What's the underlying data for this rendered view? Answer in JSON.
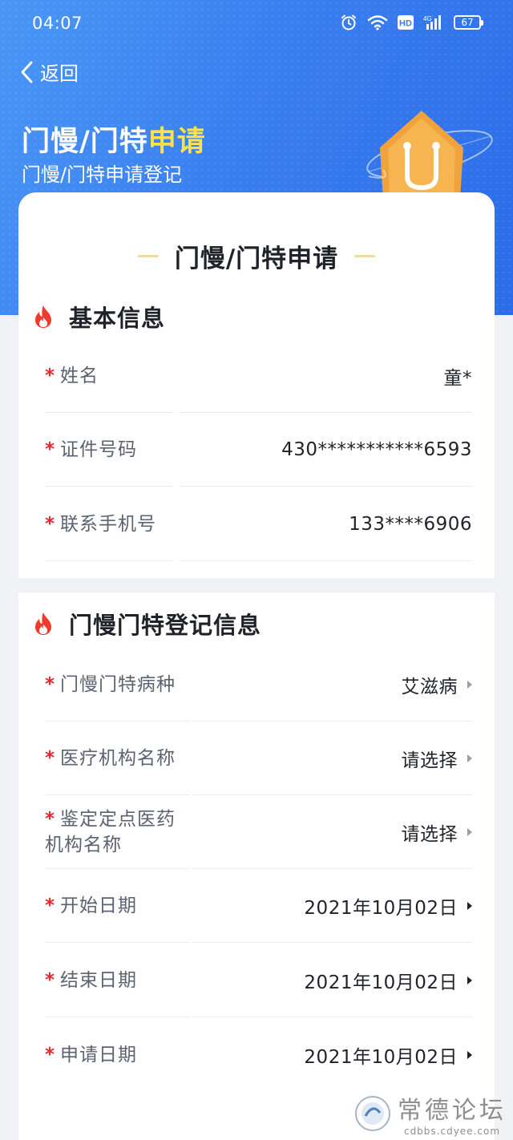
{
  "status": {
    "time": "04:07",
    "battery": "67"
  },
  "nav": {
    "back_label": "返回"
  },
  "hero": {
    "title_main": "门慢/门特",
    "title_highlight": "申请",
    "subtitle": "门慢/门特申请登记"
  },
  "card": {
    "title": "门慢/门特申请"
  },
  "basic": {
    "heading": "基本信息",
    "fields": [
      {
        "label": "姓名",
        "value": "童*"
      },
      {
        "label": "证件号码",
        "value": "430***********6593"
      },
      {
        "label": "联系手机号",
        "value": "133****6906"
      }
    ]
  },
  "register": {
    "heading": "门慢门特登记信息",
    "fields": [
      {
        "label": "门慢门特病种",
        "value": "艾滋病"
      },
      {
        "label": "医疗机构名称",
        "value": "请选择"
      },
      {
        "label_line1": "鉴定定点医药",
        "label_line2": "机构名称",
        "value": "请选择"
      },
      {
        "label": "开始日期",
        "value": "2021年10月02日"
      },
      {
        "label": "结束日期",
        "value": "2021年10月02日"
      },
      {
        "label": "申请日期",
        "value": "2021年10月02日"
      }
    ]
  },
  "required_mark": "*",
  "watermark": {
    "text": "常德论坛",
    "url": "cdbbs.cdyee.com"
  },
  "colors": {
    "accent": "#3a7ff0",
    "highlight": "#ffe14a",
    "required": "#e8262d",
    "flame": "#ef3b2d"
  }
}
